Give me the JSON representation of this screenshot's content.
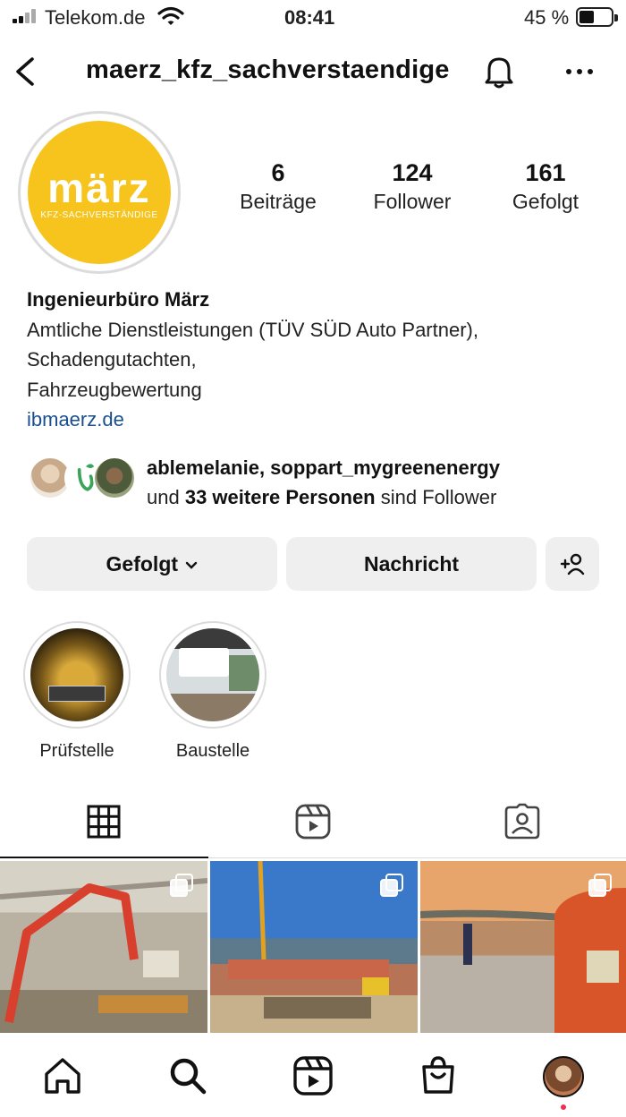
{
  "status_bar": {
    "carrier": "Telekom.de",
    "time": "08:41",
    "battery": "45 %",
    "battery_level": 0.45
  },
  "header": {
    "username": "maerz_kfz_sachverstaendige",
    "icons": [
      "back-chevron-icon",
      "bell-icon",
      "more-dots-icon"
    ]
  },
  "profile": {
    "avatar_logo": "märz",
    "avatar_logo_sub": "KFZ-SACHVERSTÄNDIGE",
    "brand_color": "#f6c41c",
    "stats": [
      {
        "value": "6",
        "label": "Beiträge"
      },
      {
        "value": "124",
        "label": "Follower"
      },
      {
        "value": "161",
        "label": "Gefolgt"
      }
    ]
  },
  "bio": {
    "name": "Ingenieurbüro März",
    "line1": "Amtliche Dienstleistungen (TÜV SÜD Auto Partner),",
    "line2": "Schadengutachten,",
    "line3": "Fahrzeugbewertung",
    "link": "ibmaerz.de",
    "link_color": "#1a4f8f"
  },
  "followed_by": {
    "names": "ablemelanie, soppart_mygreenenergy",
    "prefix": "und",
    "count_text": "33 weitere Personen",
    "suffix": "sind Follower"
  },
  "actions": {
    "follow": "Gefolgt",
    "message": "Nachricht",
    "add_icon": "add-person-icon"
  },
  "highlights": [
    {
      "label": "Prüfstelle"
    },
    {
      "label": "Baustelle"
    }
  ],
  "tabs": [
    "grid-icon",
    "reels-icon",
    "tagged-icon"
  ],
  "bottom_nav": [
    "home-icon",
    "search-icon",
    "reels-icon",
    "shop-icon",
    "profile-avatar"
  ]
}
